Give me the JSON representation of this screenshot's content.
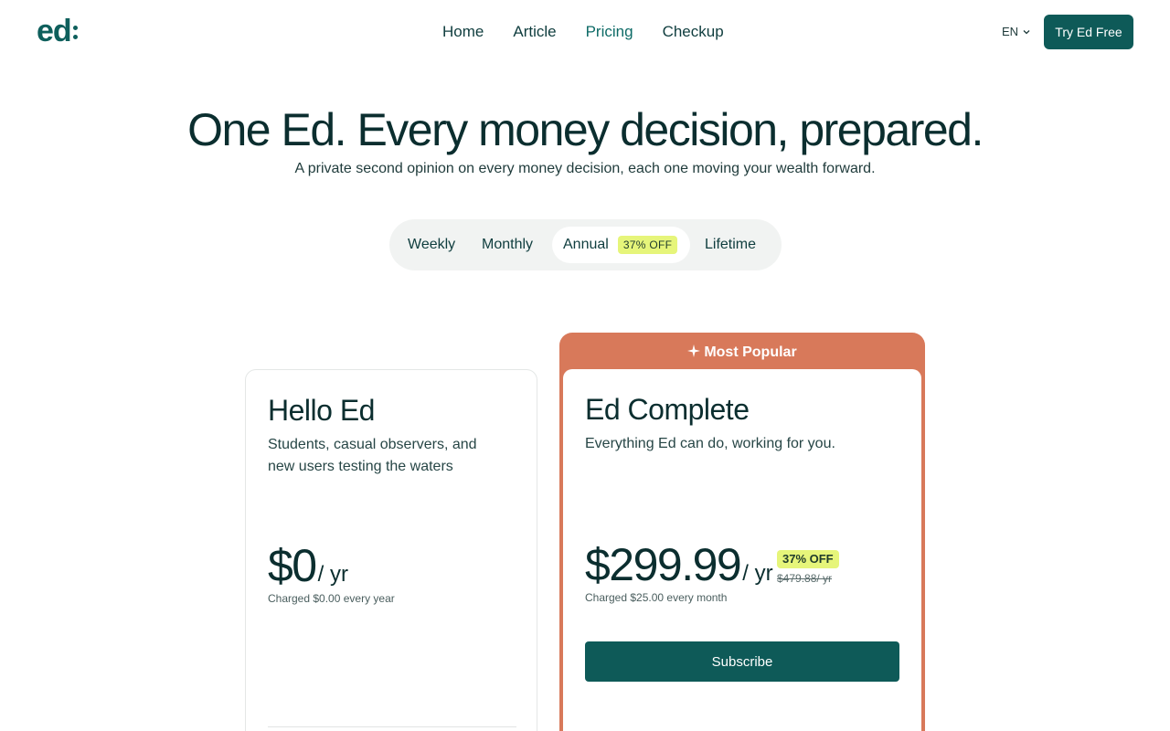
{
  "header": {
    "logo_text": "ed",
    "nav": [
      {
        "label": "Home"
      },
      {
        "label": "Article"
      },
      {
        "label": "Pricing"
      },
      {
        "label": "Checkup"
      }
    ],
    "active_nav": "Pricing",
    "language": "EN",
    "cta_label": "Try Ed Free"
  },
  "hero": {
    "title": "One Ed. Every money decision, prepared.",
    "subtitle": "A private second opinion on every money decision, each one moving your wealth forward."
  },
  "billing_toggle": {
    "options": [
      {
        "label": "Weekly"
      },
      {
        "label": "Monthly"
      },
      {
        "label": "Annual",
        "badge": "37% OFF"
      },
      {
        "label": "Lifetime"
      }
    ],
    "selected": "Annual"
  },
  "plans": {
    "free": {
      "name": "Hello Ed",
      "description": "Students, casual observers, and new users testing the waters",
      "price": "$0",
      "period": "/ yr",
      "charged": "Charged $0.00 every year"
    },
    "complete": {
      "popular_label": "Most Popular",
      "name": "Ed Complete",
      "description": "Everything Ed can do, working for you.",
      "price": "$299.99",
      "period": "/ yr",
      "discount_badge": "37% OFF",
      "original_price": "$479.88/ yr",
      "charged": "Charged $25.00 every month",
      "cta_label": "Subscribe"
    }
  },
  "colors": {
    "brand": "#0e5a58",
    "popular": "#d8795a",
    "badge": "#e6f57a"
  }
}
